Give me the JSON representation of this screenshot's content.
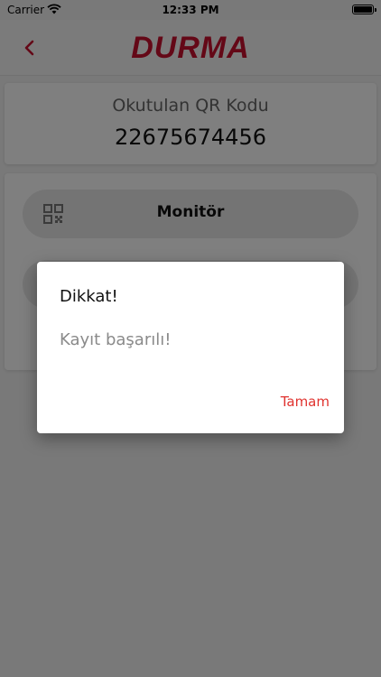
{
  "status_bar": {
    "carrier": "Carrier",
    "time": "12:33 PM"
  },
  "nav": {
    "logo": "DURMA",
    "back_icon": "chevron-left-icon",
    "brand_color": "#c8102e"
  },
  "qr_info": {
    "title": "Okutulan QR Kodu",
    "value": "22675674456"
  },
  "menu": {
    "items": [
      {
        "label": "Monitör",
        "icon": "qr-code-icon"
      },
      {
        "label": "",
        "icon": ""
      }
    ]
  },
  "dialog": {
    "title": "Dikkat!",
    "message": "Kayıt başarılı!",
    "ok_label": "Tamam",
    "accent_color": "#e0332f"
  }
}
